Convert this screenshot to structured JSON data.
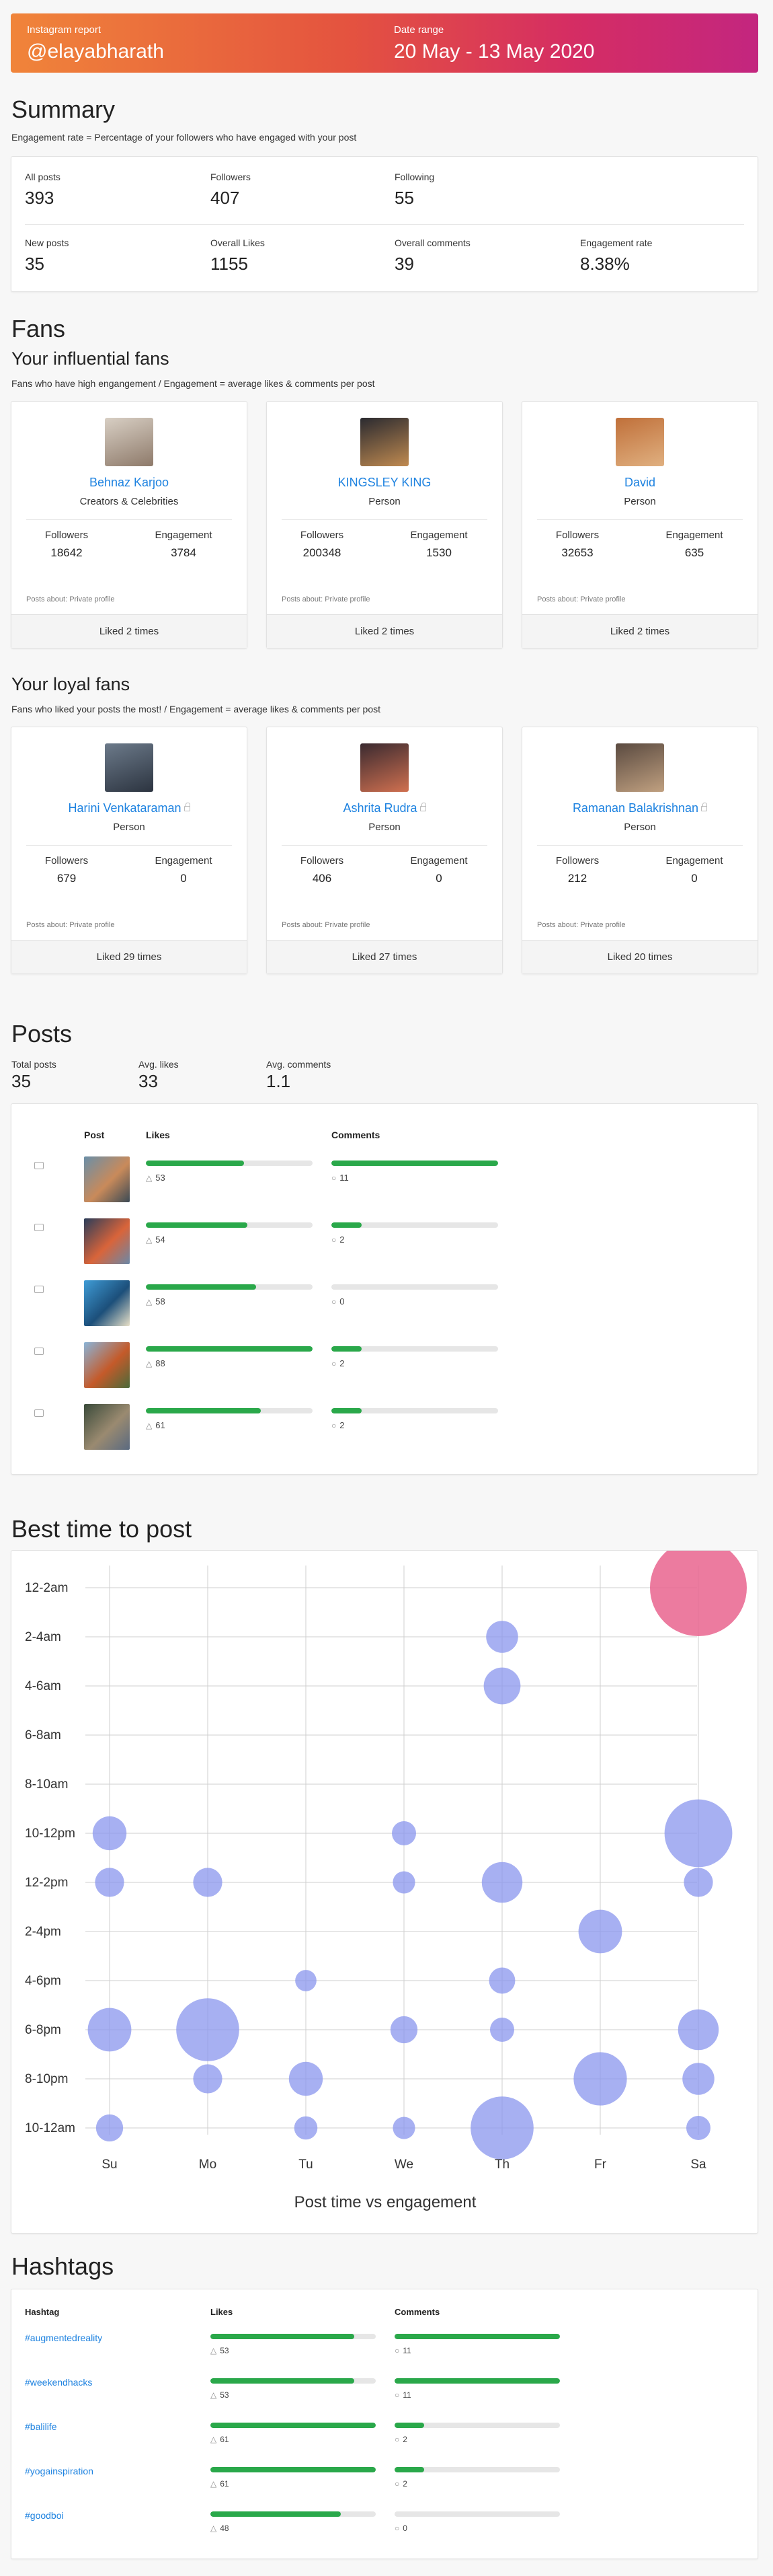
{
  "header": {
    "report_label": "Instagram report",
    "username": "@elayabharath",
    "date_label": "Date range",
    "date_range": "20 May - 13 May 2020",
    "gradient_colors": [
      "#f0843a",
      "#e4533f",
      "#d52d63",
      "#c3267f"
    ]
  },
  "summary": {
    "title": "Summary",
    "note": "Engagement rate = Percentage of your followers who have engaged with your post",
    "stats": [
      {
        "label": "All posts",
        "value": "393"
      },
      {
        "label": "Followers",
        "value": "407"
      },
      {
        "label": "Following",
        "value": "55"
      },
      {
        "label": "New posts",
        "value": "35"
      },
      {
        "label": "Overall Likes",
        "value": "1155"
      },
      {
        "label": "Overall comments",
        "value": "39"
      },
      {
        "label": "Engagement rate",
        "value": "8.38%"
      }
    ]
  },
  "fans": {
    "title": "Fans",
    "followers_label": "Followers",
    "engagement_label": "Engagement",
    "influential": {
      "title": "Your influential fans",
      "note": "Fans who have high engangement / Engagement = average likes & comments per post",
      "items": [
        {
          "name": "Behnaz Karjoo",
          "category": "Creators & Celebrities",
          "followers": "18642",
          "engagement": "3784",
          "about": "Posts about: Private profile",
          "liked": "Liked 2 times"
        },
        {
          "name": "KINGSLEY KING",
          "category": "Person",
          "followers": "200348",
          "engagement": "1530",
          "about": "Posts about: Private profile",
          "liked": "Liked 2 times"
        },
        {
          "name": "David",
          "category": "Person",
          "followers": "32653",
          "engagement": "635",
          "about": "Posts about: Private profile",
          "liked": "Liked 2 times"
        }
      ]
    },
    "loyal": {
      "title": "Your loyal fans",
      "note": "Fans who liked your posts the most! / Engagement = average likes & comments per post",
      "items": [
        {
          "name": "Harini Venkataraman",
          "category": "Person",
          "followers": "679",
          "engagement": "0",
          "about": "Posts about: Private profile",
          "liked": "Liked 29 times"
        },
        {
          "name": "Ashrita Rudra",
          "category": "Person",
          "followers": "406",
          "engagement": "0",
          "about": "Posts about: Private profile",
          "liked": "Liked 27 times"
        },
        {
          "name": "Ramanan Balakrishnan",
          "category": "Person",
          "followers": "212",
          "engagement": "0",
          "about": "Posts about: Private profile",
          "liked": "Liked 20 times"
        }
      ]
    }
  },
  "posts": {
    "title": "Posts",
    "stats": [
      {
        "label": "Total posts",
        "value": "35"
      },
      {
        "label": "Avg. likes",
        "value": "33"
      },
      {
        "label": "Avg. comments",
        "value": "1.1"
      }
    ],
    "col_post": "Post",
    "col_likes": "Likes",
    "col_comments": "Comments",
    "rows": [
      {
        "type_icon": "video-icon",
        "likes": 53,
        "likes_fraction": 0.59,
        "comments": 11,
        "comments_fraction": 1.0,
        "thumb_colors": [
          "#6a8fa8",
          "#c98a5a",
          "#3b4a55"
        ]
      },
      {
        "type_icon": "image-icon",
        "likes": 54,
        "likes_fraction": 0.61,
        "comments": 2,
        "comments_fraction": 0.18,
        "thumb_colors": [
          "#2b3d5a",
          "#d9643a",
          "#6a88a8"
        ]
      },
      {
        "type_icon": "carousel-icon",
        "likes": 58,
        "likes_fraction": 0.66,
        "comments": 0,
        "comments_fraction": 0.0,
        "thumb_colors": [
          "#3f9cd6",
          "#1c4f7a",
          "#e8e0c8"
        ]
      },
      {
        "type_icon": "image-icon",
        "likes": 88,
        "likes_fraction": 1.0,
        "comments": 2,
        "comments_fraction": 0.18,
        "thumb_colors": [
          "#8ab4d8",
          "#c45a2a",
          "#4a6a3a"
        ]
      },
      {
        "type_icon": "image-icon",
        "likes": 61,
        "likes_fraction": 0.69,
        "comments": 2,
        "comments_fraction": 0.18,
        "thumb_colors": [
          "#3a4a3a",
          "#9a8a70",
          "#5a6a80"
        ]
      }
    ]
  },
  "best_time": {
    "title": "Best time to post"
  },
  "chart_data": {
    "type": "scatter",
    "title": "Post time vs engagement",
    "x_categories": [
      "Su",
      "Mo",
      "Tu",
      "We",
      "Th",
      "Fr",
      "Sa"
    ],
    "y_categories": [
      "12-2am",
      "2-4am",
      "4-6am",
      "6-8am",
      "8-10am",
      "10-12pm",
      "12-2pm",
      "2-4pm",
      "4-6pm",
      "6-8pm",
      "8-10pm",
      "10-12am"
    ],
    "grid": true,
    "bubble_color": "#8a96ee",
    "highlight_color": "#e9648e",
    "points": [
      {
        "x": "Sa",
        "y": "12-2am",
        "size": 1.0,
        "highlight": true
      },
      {
        "x": "Th",
        "y": "2-4am",
        "size": 0.33
      },
      {
        "x": "Th",
        "y": "4-6am",
        "size": 0.38
      },
      {
        "x": "Su",
        "y": "10-12pm",
        "size": 0.35
      },
      {
        "x": "We",
        "y": "10-12pm",
        "size": 0.25
      },
      {
        "x": "Sa",
        "y": "10-12pm",
        "size": 0.7
      },
      {
        "x": "Su",
        "y": "12-2pm",
        "size": 0.3
      },
      {
        "x": "Mo",
        "y": "12-2pm",
        "size": 0.3
      },
      {
        "x": "We",
        "y": "12-2pm",
        "size": 0.23
      },
      {
        "x": "Th",
        "y": "12-2pm",
        "size": 0.42
      },
      {
        "x": "Sa",
        "y": "12-2pm",
        "size": 0.3
      },
      {
        "x": "Fr",
        "y": "2-4pm",
        "size": 0.45
      },
      {
        "x": "Tu",
        "y": "4-6pm",
        "size": 0.22
      },
      {
        "x": "Th",
        "y": "4-6pm",
        "size": 0.27
      },
      {
        "x": "Su",
        "y": "6-8pm",
        "size": 0.45
      },
      {
        "x": "Mo",
        "y": "6-8pm",
        "size": 0.65
      },
      {
        "x": "We",
        "y": "6-8pm",
        "size": 0.28
      },
      {
        "x": "Th",
        "y": "6-8pm",
        "size": 0.25
      },
      {
        "x": "Sa",
        "y": "6-8pm",
        "size": 0.42
      },
      {
        "x": "Mo",
        "y": "8-10pm",
        "size": 0.3
      },
      {
        "x": "Tu",
        "y": "8-10pm",
        "size": 0.35
      },
      {
        "x": "Fr",
        "y": "8-10pm",
        "size": 0.55
      },
      {
        "x": "Sa",
        "y": "8-10pm",
        "size": 0.33
      },
      {
        "x": "Su",
        "y": "10-12am",
        "size": 0.28
      },
      {
        "x": "Tu",
        "y": "10-12am",
        "size": 0.24
      },
      {
        "x": "We",
        "y": "10-12am",
        "size": 0.23
      },
      {
        "x": "Th",
        "y": "10-12am",
        "size": 0.65
      },
      {
        "x": "Sa",
        "y": "10-12am",
        "size": 0.25
      }
    ]
  },
  "hashtags": {
    "title": "Hashtags",
    "col_hashtag": "Hashtag",
    "col_likes": "Likes",
    "col_comments": "Comments",
    "rows": [
      {
        "tag": "#augmentedreality",
        "likes": 53,
        "likes_fraction": 0.87,
        "comments": 11,
        "comments_fraction": 1.0
      },
      {
        "tag": "#weekendhacks",
        "likes": 53,
        "likes_fraction": 0.87,
        "comments": 11,
        "comments_fraction": 1.0
      },
      {
        "tag": "#balilife",
        "likes": 61,
        "likes_fraction": 1.0,
        "comments": 2,
        "comments_fraction": 0.18
      },
      {
        "tag": "#yogainspiration",
        "likes": 61,
        "likes_fraction": 1.0,
        "comments": 2,
        "comments_fraction": 0.18
      },
      {
        "tag": "#goodboi",
        "likes": 48,
        "likes_fraction": 0.79,
        "comments": 0,
        "comments_fraction": 0.0
      }
    ]
  }
}
